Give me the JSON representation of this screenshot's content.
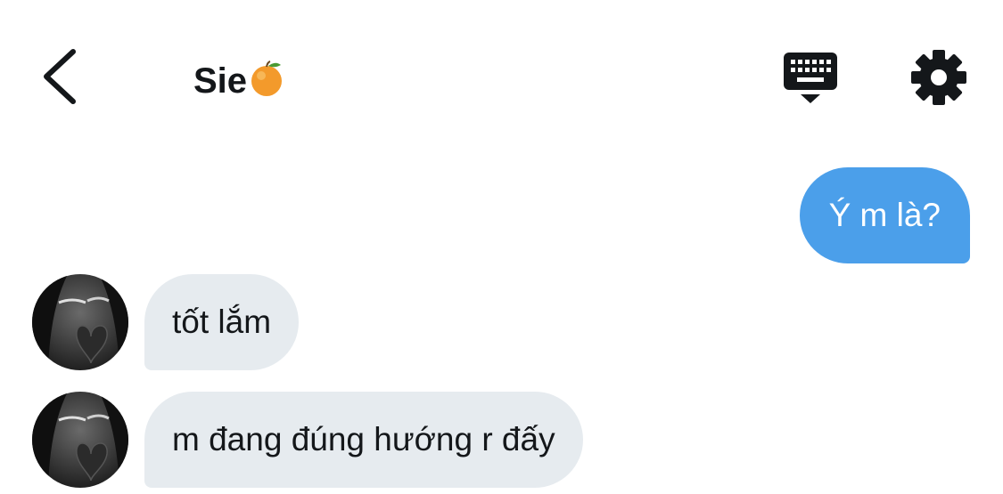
{
  "header": {
    "title": "Sie",
    "title_emoji_icon": "tangerine-icon",
    "back_icon": "chevron-left-icon",
    "keyboard_icon": "keyboard-hide-icon",
    "settings_icon": "gear-icon"
  },
  "messages": [
    {
      "direction": "sent",
      "text": "Ý m là?"
    },
    {
      "direction": "received",
      "text": "tốt lắm"
    },
    {
      "direction": "received",
      "text": "m đang đúng hướng r đấy"
    }
  ],
  "colors": {
    "sent_bubble": "#4b9fea",
    "received_bubble": "#e6ebef",
    "text": "#14171a"
  }
}
